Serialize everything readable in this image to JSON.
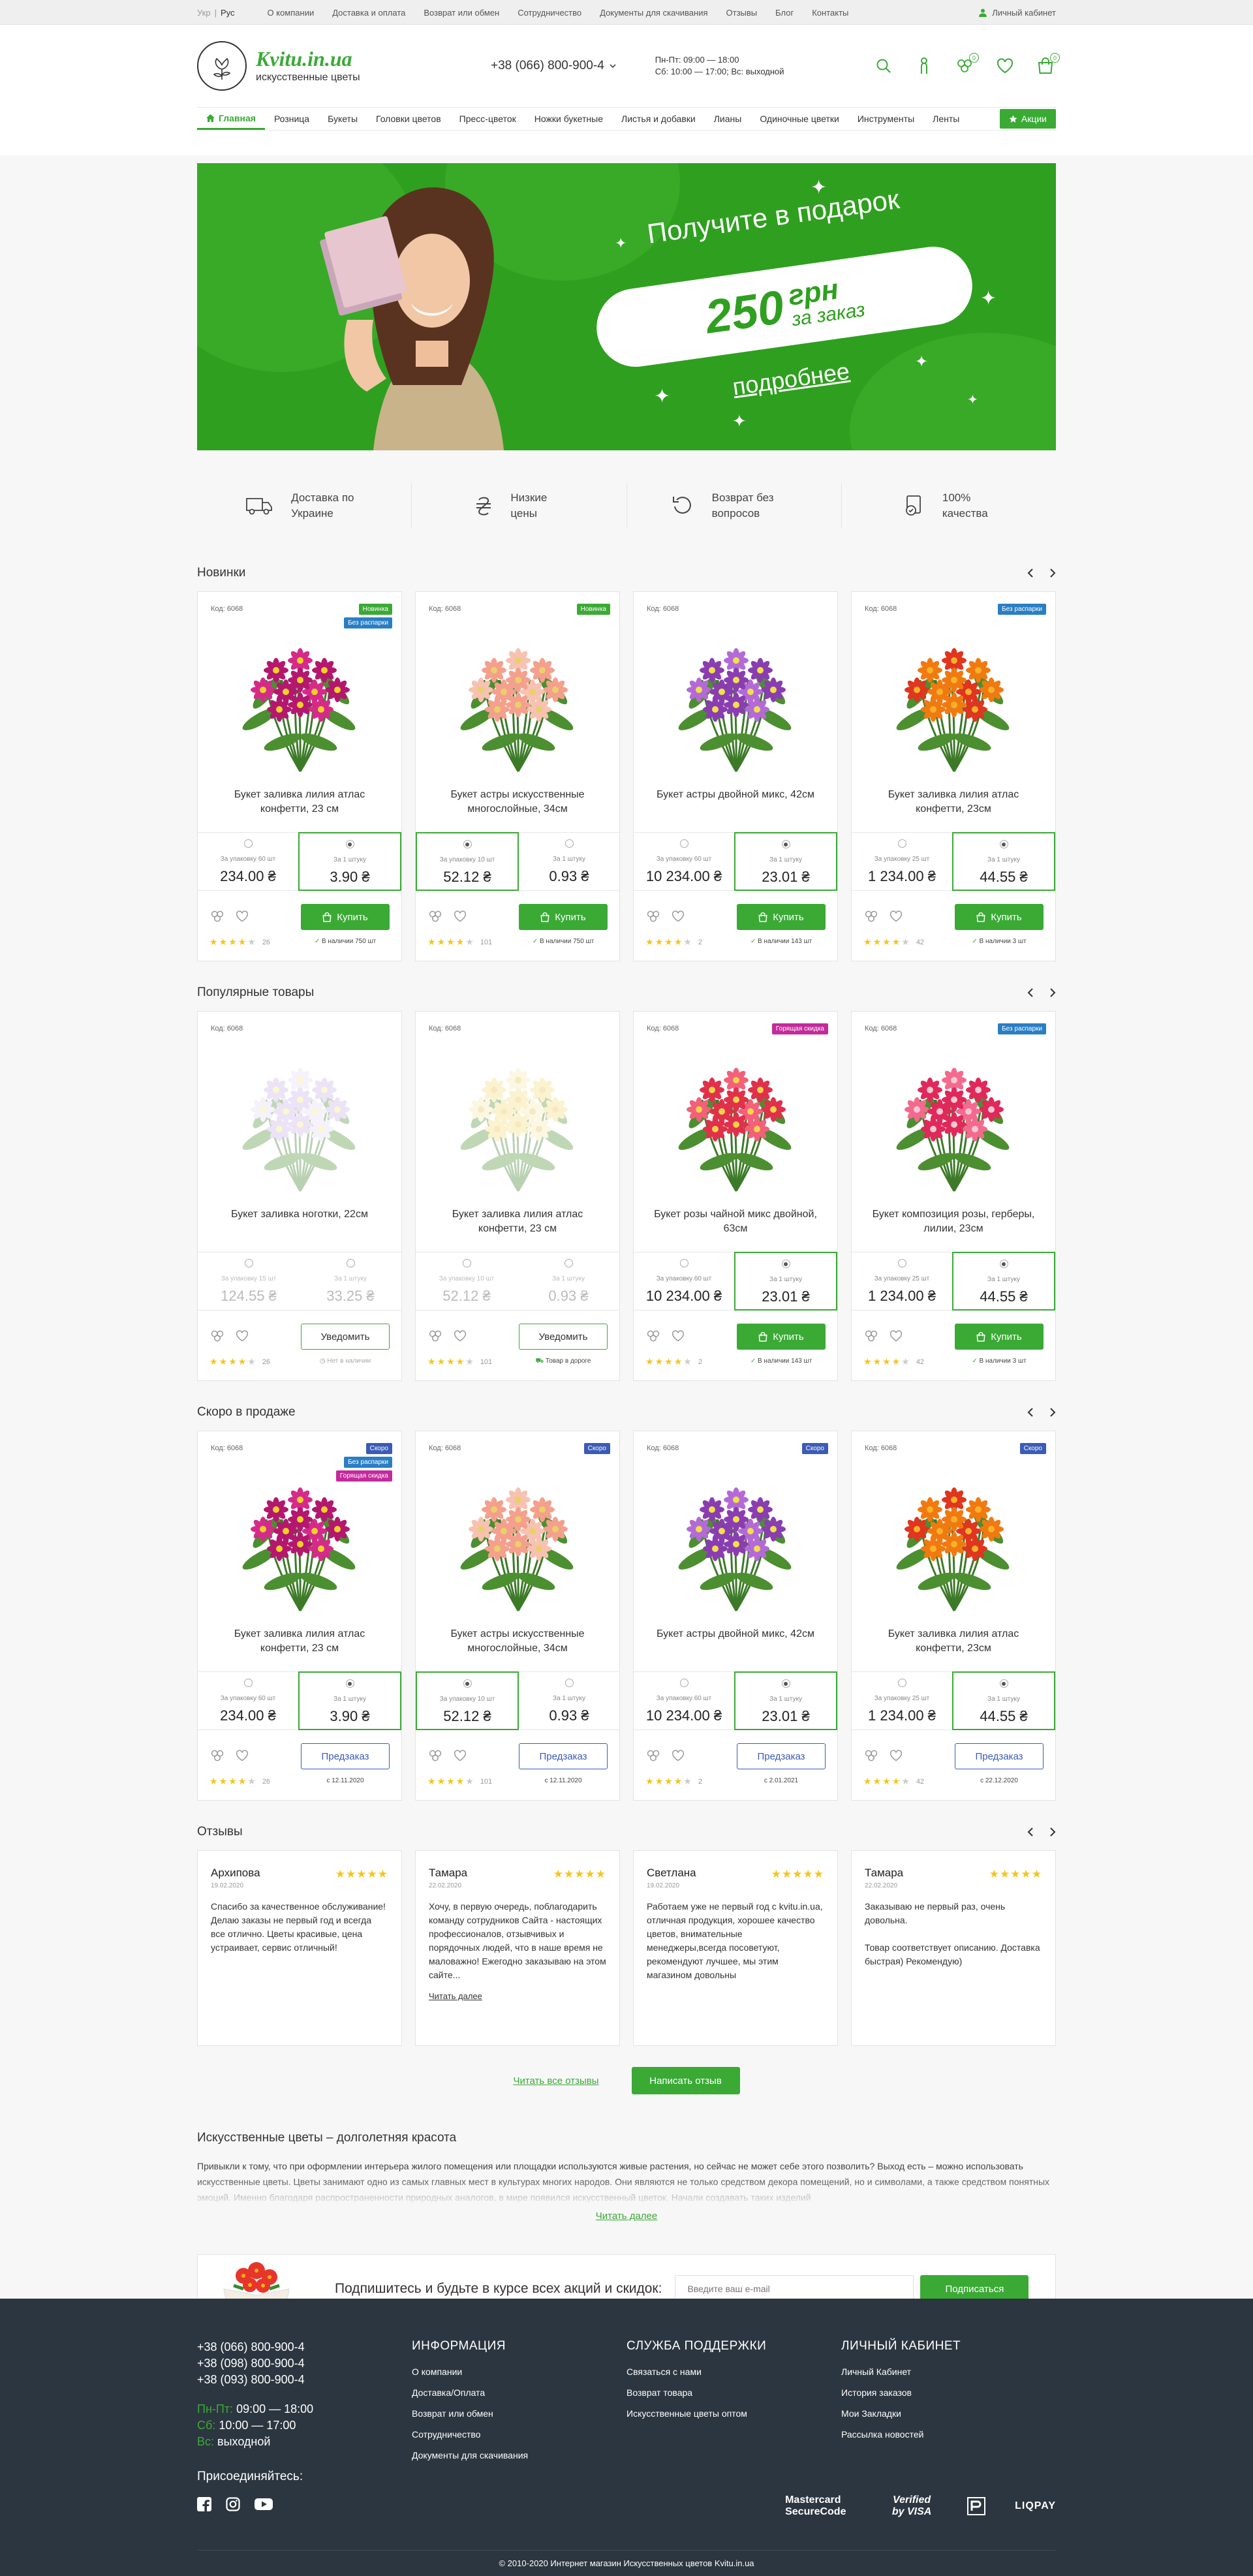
{
  "topbar": {
    "lang": [
      "Укр",
      "Рус"
    ],
    "nav": [
      "О компании",
      "Доставка и оплата",
      "Возврат или обмен",
      "Сотрудничество",
      "Документы для скачивания",
      "Отзывы",
      "Блог",
      "Контакты"
    ],
    "cabinet": "Личный кабинет"
  },
  "header": {
    "logo_name": "Kvitu.in.ua",
    "logo_sub": "искусственные цветы",
    "phone": "+38 (066) 800-900-4",
    "hours": [
      "Пн-Пт: 09:00 — 18:00",
      "Сб: 10:00 — 17:00; Вс: выходной"
    ],
    "compare_count": "0",
    "cart_count": "0"
  },
  "catnav": [
    "Главная",
    "Розница",
    "Букеты",
    "Головки цветов",
    "Пресс-цветок",
    "Ножки букетные",
    "Листья и добавки",
    "Лианы",
    "Одиночные цветки",
    "Инструменты",
    "Ленты"
  ],
  "catnav_promo": "Акции",
  "banner": {
    "title": "Получите в подарок",
    "amount": "250",
    "currency": "грн",
    "per_order": "за заказ",
    "more": "подробнее"
  },
  "features": [
    {
      "icon": "truck-icon",
      "text": "Доставка по Украине"
    },
    {
      "icon": "hryvnia-icon",
      "text": "Низкие цены"
    },
    {
      "icon": "return-icon",
      "text": "Возврат без вопросов"
    },
    {
      "icon": "quality-icon",
      "text": "100% качества"
    }
  ],
  "colors": {
    "accent": "#3aaa35",
    "new": "#3aaa35",
    "no_stock_label": "#2a7fc4",
    "hot": "#c42a9c",
    "soon": "#3b5bb5",
    "footer": "#2c3640"
  },
  "sections": [
    {
      "title": "Новинки",
      "products": [
        {
          "code": "Код: 6068",
          "labels": [
            [
              "Новинка",
              "#3aaa35"
            ],
            [
              "Без распарки",
              "#2a7fc4"
            ]
          ],
          "name": "Букет заливка лилия атлас конфетти, 23 см",
          "p1_label": "За упаковку 60 шт",
          "p1": "234.00 ₴",
          "p2_label": "За 1 штуку",
          "p2": "3.90 ₴",
          "sel": 2,
          "btn": "Купить",
          "btn_type": "buy",
          "stars": 4,
          "reviews": "26",
          "stock": "В наличии 750 шт",
          "flower": "magenta"
        },
        {
          "code": "Код: 6068",
          "labels": [
            [
              "Новинка",
              "#3aaa35"
            ]
          ],
          "name": "Букет астры искусственные многослойные, 34см",
          "p1_label": "За упаковку 10 шт",
          "p1": "52.12 ₴",
          "p2_label": "За 1 штуку",
          "p2": "0.93 ₴",
          "sel": 1,
          "btn": "Купить",
          "btn_type": "buy",
          "stars": 4,
          "reviews": "101",
          "stock": "В наличии 750 шт",
          "flower": "peach"
        },
        {
          "code": "Код: 6068",
          "labels": [],
          "name": "Букет астры двойной микс, 42см",
          "p1_label": "За упаковку 60 шт",
          "p1": "10 234.00 ₴",
          "p2_label": "За 1 штуку",
          "p2": "23.01 ₴",
          "sel": 2,
          "btn": "Купить",
          "btn_type": "buy",
          "stars": 4,
          "reviews": "2",
          "stock": "В наличии 143 шт",
          "flower": "purple"
        },
        {
          "code": "Код: 6068",
          "labels": [
            [
              "Без распарки",
              "#2a7fc4"
            ]
          ],
          "name": "Букет заливка лилия атлас конфетти, 23см",
          "p1_label": "За упаковку 25 шт",
          "p1": "1 234.00 ₴",
          "p2_label": "За 1 штуку",
          "p2": "44.55 ₴",
          "sel": 2,
          "btn": "Купить",
          "btn_type": "buy",
          "stars": 4,
          "reviews": "42",
          "stock": "В наличии 3 шт",
          "flower": "orange"
        }
      ]
    },
    {
      "title": "Популярные товары",
      "products": [
        {
          "code": "Код: 6068",
          "labels": [],
          "name": "Букет заливка ноготки, 22см",
          "p1_label": "За упаковку 15 шт",
          "p1": "124.55 ₴",
          "p2_label": "За 1 штуку",
          "p2": "33.25 ₴",
          "sel": 0,
          "btn": "Уведомить",
          "btn_type": "notify",
          "stars": 4,
          "reviews": "26",
          "stock": "Нет в наличии",
          "flower": "pale-violet",
          "faded": true
        },
        {
          "code": "Код: 6068",
          "labels": [],
          "name": "Букет заливка лилия атлас конфетти, 23 см",
          "p1_label": "За упаковку 10 шт",
          "p1": "52.12 ₴",
          "p2_label": "За 1 штуку",
          "p2": "0.93 ₴",
          "sel": 0,
          "btn": "Уведомить",
          "btn_type": "notify",
          "stars": 4,
          "reviews": "101",
          "stock": "Товар в дороге",
          "flower": "pale-yellow",
          "faded": true
        },
        {
          "code": "Код: 6068",
          "labels": [
            [
              "Горящая скидка",
              "#c42a9c"
            ]
          ],
          "name": "Букет розы чайной микс двойной, 63см",
          "p1_label": "За упаковку 60 шт",
          "p1": "10 234.00 ₴",
          "p2_label": "За 1 штуку",
          "p2": "23.01 ₴",
          "sel": 2,
          "btn": "Купить",
          "btn_type": "buy",
          "stars": 4,
          "reviews": "2",
          "stock": "В наличии 143 шт",
          "flower": "red-lily"
        },
        {
          "code": "Код: 6068",
          "labels": [
            [
              "Без распарки",
              "#2a7fc4"
            ]
          ],
          "name": "Букет композиция розы, герберы, лилии, 23см",
          "p1_label": "За упаковку 25 шт",
          "p1": "1 234.00 ₴",
          "p2_label": "За 1 штуку",
          "p2": "44.55 ₴",
          "sel": 2,
          "btn": "Купить",
          "btn_type": "buy",
          "stars": 4,
          "reviews": "42",
          "stock": "В наличии 3 шт",
          "flower": "pink-rose"
        }
      ]
    },
    {
      "title": "Скоро в продаже",
      "products": [
        {
          "code": "Код: 6068",
          "labels": [
            [
              "Скоро",
              "#3b5bb5"
            ],
            [
              "Без распарки",
              "#2a7fc4"
            ],
            [
              "Горящая скидка",
              "#c42a9c"
            ]
          ],
          "name": "Букет заливка лилия атлас конфетти, 23 см",
          "p1_label": "За упаковку 60 шт",
          "p1": "234.00 ₴",
          "p2_label": "За 1 штуку",
          "p2": "3.90 ₴",
          "sel": 2,
          "btn": "Предзаказ",
          "btn_type": "pre",
          "stars": 4,
          "reviews": "26",
          "stock": "с 12.11.2020",
          "flower": "magenta"
        },
        {
          "code": "Код: 6068",
          "labels": [
            [
              "Скоро",
              "#3b5bb5"
            ]
          ],
          "name": "Букет астры искусственные многослойные, 34см",
          "p1_label": "За упаковку 10 шт",
          "p1": "52.12 ₴",
          "p2_label": "За 1 штуку",
          "p2": "0.93 ₴",
          "sel": 1,
          "btn": "Предзаказ",
          "btn_type": "pre",
          "stars": 4,
          "reviews": "101",
          "stock": "с 12.11.2020",
          "flower": "peach"
        },
        {
          "code": "Код: 6068",
          "labels": [
            [
              "Скоро",
              "#3b5bb5"
            ]
          ],
          "name": "Букет астры двойной микс, 42см",
          "p1_label": "За упаковку 60 шт",
          "p1": "10 234.00 ₴",
          "p2_label": "За 1 штуку",
          "p2": "23.01 ₴",
          "sel": 2,
          "btn": "Предзаказ",
          "btn_type": "pre",
          "stars": 4,
          "reviews": "2",
          "stock": "с 2.01.2021",
          "flower": "purple"
        },
        {
          "code": "Код: 6068",
          "labels": [
            [
              "Скоро",
              "#3b5bb5"
            ]
          ],
          "name": "Букет заливка лилия атлас конфетти, 23см",
          "p1_label": "За упаковку 25 шт",
          "p1": "1 234.00 ₴",
          "p2_label": "За 1 штуку",
          "p2": "44.55 ₴",
          "sel": 2,
          "btn": "Предзаказ",
          "btn_type": "pre",
          "stars": 4,
          "reviews": "42",
          "stock": "с 22.12.2020",
          "flower": "orange"
        }
      ]
    }
  ],
  "reviews": {
    "title": "Отзывы",
    "items": [
      {
        "name": "Архипова",
        "date": "19.02.2020",
        "text": "Спасибо за качественное обслуживание! Делаю заказы не первый год и всегда все отлично. Цветы красивые, цена устраивает, сервис отличный!",
        "more": ""
      },
      {
        "name": "Тамара",
        "date": "22.02.2020",
        "text": "Хочу, в первую очередь, поблагодарить команду сотрудников Сайта - настоящих профессионалов, отзывчивых и порядочных людей, что в наше время не маловажно! Ежегодно заказываю на этом сайте...",
        "more": "Читать далее"
      },
      {
        "name": "Светлана",
        "date": "19.02.2020",
        "text": "Работаем уже не первый год с kvitu.in.ua, отличная продукция, хорошее качество цветов, внимательные менеджеры,всегда посоветуют, рекомендуют лучшее, мы этим магазином довольны",
        "more": ""
      },
      {
        "name": "Тамара",
        "date": "22.02.2020",
        "text": "Заказываю не первый раз, очень довольна.\n\nТовар соответствует описанию. Доставка быстрая) Рекомендую)",
        "more": ""
      }
    ],
    "all_link": "Читать все отзывы",
    "write_btn": "Написать отзыв"
  },
  "seo": {
    "title": "Искусственные цветы – долголетняя красота",
    "text": "Привыкли к тому, что при оформлении интерьера жилого помещения или площадки используются живые растения, но сейчас не может себе этого позволить? Выход есть – можно использовать искусственные цветы. Цветы занимают одно из самых главных мест в культурах многих народов. Они являются не только средством декора помещений, но и символами, а также средством понятных эмоций. Именно благодаря распространенности природных аналогов, в мире появился искусственный цветок. Начали создавать таких изделий",
    "more": "Читать далее"
  },
  "subscribe": {
    "text": "Подпишитесь и будьте в курсе всех акций и скидок:",
    "placeholder": "Введите ваш e-mail",
    "button": "Подписаться"
  },
  "footer": {
    "phones": [
      "+38 (066) 800-900-4",
      "+38 (098) 800-900-4",
      "+38 (093) 800-900-4"
    ],
    "hours": [
      [
        "Пн-Пт:",
        " 09:00 — 18:00"
      ],
      [
        "Сб:",
        " 10:00 — 17:00"
      ],
      [
        "Вс:",
        " выходной"
      ]
    ],
    "join": "Присоединяйтесь:",
    "info_title": "ИНФОРМАЦИЯ",
    "info": [
      "О компании",
      "Доставка/Оплата",
      "Возврат или обмен",
      "Сотрудничество",
      "Документы для скачивания"
    ],
    "support_title": "СЛУЖБА ПОДДЕРЖКИ",
    "support": [
      "Связаться с нами",
      "Возврат товара",
      "Искусственные цветы оптом"
    ],
    "cabinet_title": "ЛИЧНЫЙ КАБИНЕТ",
    "cabinet": [
      "Личный Кабинет",
      "История заказов",
      "Мои Закладки",
      "Рассылка новостей"
    ],
    "payments": [
      "Mastercard SecureCode",
      "Verified by VISA",
      "LIQPAY"
    ],
    "copyright": "© 2010-2020 Интернет магазин Искусственных цветов Kvitu.in.ua"
  }
}
